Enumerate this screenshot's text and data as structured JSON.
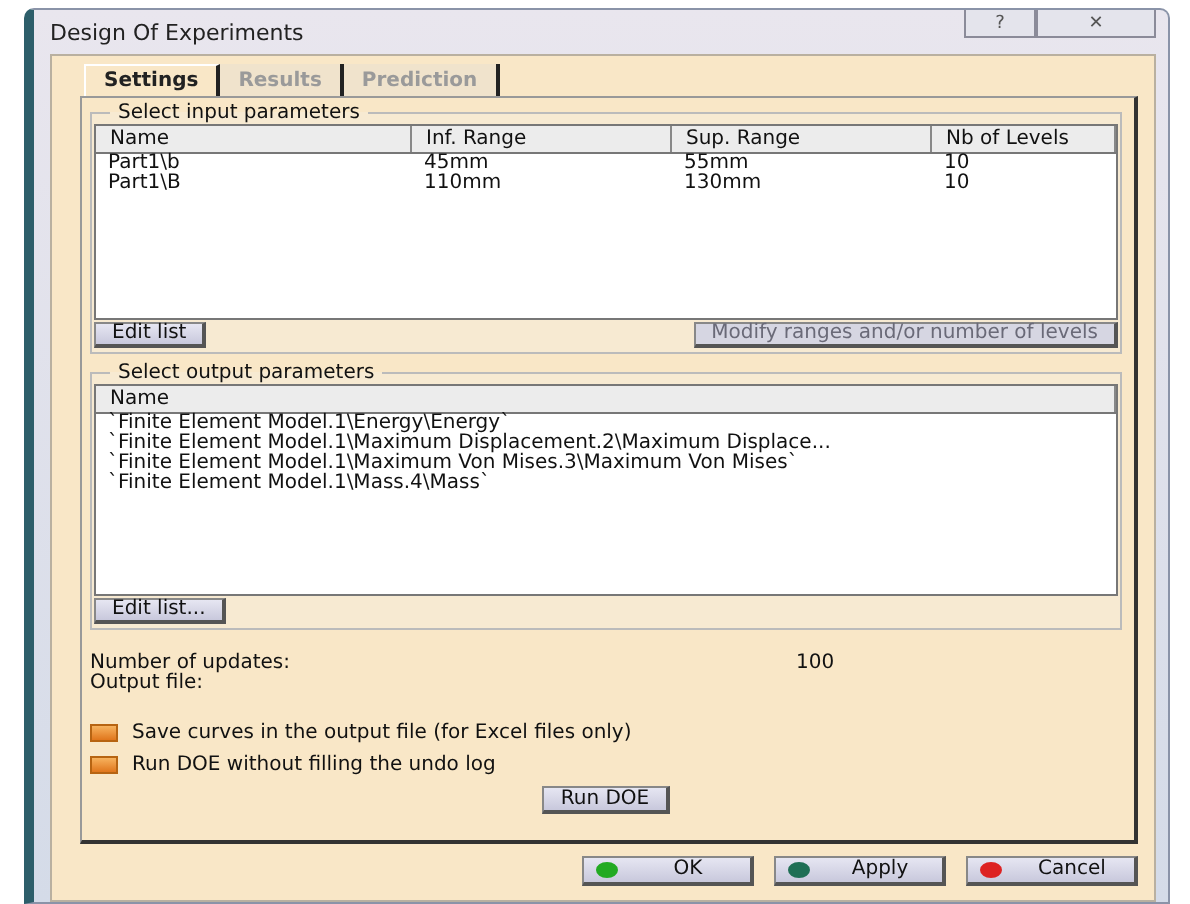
{
  "window": {
    "title": "Design Of Experiments",
    "controls": [
      "?",
      "✕"
    ]
  },
  "tabs": [
    {
      "label": "Settings",
      "selected": true,
      "disabled": false
    },
    {
      "label": "Results",
      "selected": false,
      "disabled": true
    },
    {
      "label": "Prediction",
      "selected": false,
      "disabled": true
    }
  ],
  "input_parameters": {
    "title": "Select input parameters",
    "columns": [
      "Name",
      "Inf. Range",
      "Sup. Range",
      "Nb of Levels"
    ],
    "rows": [
      [
        "Part1\\b",
        "45mm",
        "55mm",
        "10"
      ],
      [
        "Part1\\B",
        "110mm",
        "130mm",
        "10"
      ]
    ],
    "buttons": [
      {
        "label": "Edit list",
        "disabled": false
      },
      {
        "label": "Modify ranges and/or number of levels",
        "disabled": true
      }
    ]
  },
  "output_parameters": {
    "title": "Select output parameters",
    "columns": [
      "Name"
    ],
    "rows": [
      "`Finite Element Model.1\\Energy\\Energy`",
      "`Finite Element Model.1\\Maximum Displacement.2\\Maximum Displace...",
      "`Finite Element Model.1\\Maximum Von Mises.3\\Maximum Von Mises`",
      "`Finite Element Model.1\\Mass.4\\Mass`"
    ],
    "button": "Edit list..."
  },
  "updates": {
    "label": "Number of updates:",
    "value": "100"
  },
  "output_file": {
    "label": "Output  file:"
  },
  "options": [
    {
      "label": "Save curves in the output file (for Excel files only)",
      "checked": false
    },
    {
      "label": "Run DOE without filling the undo log",
      "checked": false
    }
  ],
  "run_button": "Run DOE",
  "footer_buttons": [
    {
      "label": "OK",
      "color": "#22aa22"
    },
    {
      "label": "Apply",
      "color": "#1f6f55"
    },
    {
      "label": "Cancel",
      "color": "#dd2222"
    }
  ]
}
